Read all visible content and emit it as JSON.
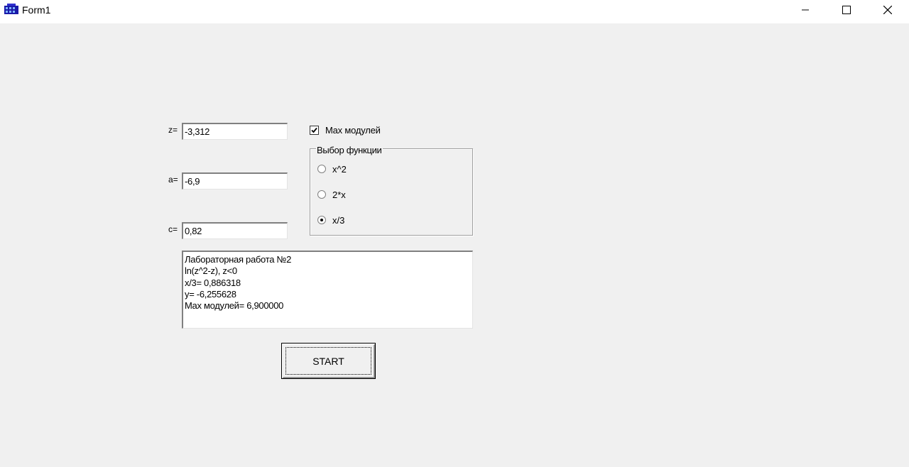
{
  "window": {
    "title": "Form1"
  },
  "fields": {
    "z": {
      "label": "z=",
      "value": "-3,312"
    },
    "a": {
      "label": "a=",
      "value": "-6,9"
    },
    "c": {
      "label": "c=",
      "value": "0,82"
    }
  },
  "max_modules": {
    "label": "Max модулей",
    "checked": true
  },
  "function_group": {
    "caption": "Выбор функции",
    "options": [
      {
        "label": "x^2",
        "selected": false
      },
      {
        "label": "2*x",
        "selected": false
      },
      {
        "label": "x/3",
        "selected": true
      }
    ]
  },
  "output": {
    "lines": [
      "Лабораторная работа №2",
      "ln(z^2-z), z<0",
      "x/3= 0,886318",
      "y= -6,255628",
      "Max модулей= 6,900000"
    ]
  },
  "start_button": {
    "label": "START"
  }
}
